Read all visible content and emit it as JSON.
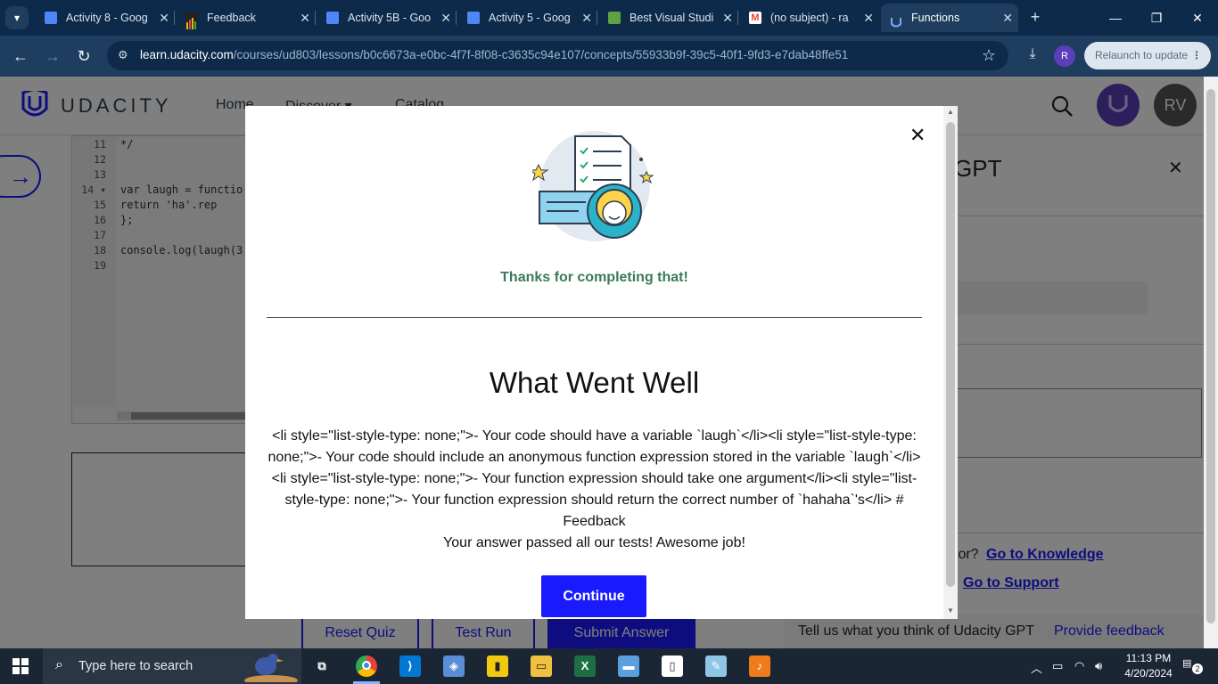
{
  "browser": {
    "tabs": [
      {
        "title": "Activity 8 - Goog",
        "icon": "google-docs-icon",
        "color": "#4f86f7"
      },
      {
        "title": "Feedback",
        "icon": "bar-chart-favicon",
        "color": "#f4b400"
      },
      {
        "title": "Activity 5B - Goo",
        "icon": "google-docs-icon",
        "color": "#4f86f7"
      },
      {
        "title": "Activity 5 - Goog",
        "icon": "google-docs-icon",
        "color": "#4f86f7"
      },
      {
        "title": "Best Visual Studi",
        "icon": "shopify-icon",
        "color": "#5ea33f"
      },
      {
        "title": "(no subject) - ra",
        "icon": "gmail-icon",
        "color": "#ea4335"
      },
      {
        "title": "Functions",
        "icon": "udacity-icon",
        "color": "#7aa7ff"
      }
    ],
    "url_domain": "learn.udacity.com",
    "url_path": "/courses/ud803/lessons/b0c6673a-e0bc-4f7f-8f08-c3635c94e107/concepts/55933b9f-39c5-40f1-9fd3-e7dab48ffe51",
    "profile_initial": "R",
    "relaunch_label": "Relaunch to update"
  },
  "page": {
    "brand": "UDACITY",
    "nav": [
      "Home",
      "Discover ▾",
      "Catalog"
    ],
    "avatar_initials": "RV",
    "editor": {
      "line_numbers": [
        "11",
        "12",
        "13",
        "14 ▾",
        "15",
        "16",
        "17",
        "18",
        "19"
      ],
      "lines": [
        "*/",
        "",
        "",
        "var laugh = functio",
        "    return 'ha'.rep",
        "};",
        "",
        "console.log(laugh(3",
        ""
      ]
    },
    "gpt_title": "GPT",
    "help_prefix": "tor?",
    "help_link_knowledge": "Go to Knowledge",
    "help_link_support": "Go to Support",
    "buttons": {
      "reset": "Reset Quiz",
      "test": "Test Run",
      "submit": "Submit Answer"
    },
    "feedback_prompt": "Tell us what you think of Udacity GPT",
    "feedback_link": "Provide feedback"
  },
  "modal": {
    "thanks": "Thanks for completing that!",
    "heading": "What Went Well",
    "body": "<li style=\"list-style-type: none;\">- Your code should have a variable `laugh`</li><li style=\"list-style-type: none;\">- Your code should include an anonymous function expression stored in the variable `laugh`</li><li style=\"list-style-type: none;\">- Your function expression should take one argument</li><li style=\"list-style-type: none;\">- Your function expression should return the correct number of `hahaha`'s</li> # Feedback",
    "result": "Your answer passed all our tests! Awesome job!",
    "continue_label": "Continue"
  },
  "taskbar": {
    "search_placeholder": "Type here to search",
    "time": "11:13 PM",
    "date": "4/20/2024",
    "notifications": "2",
    "apps": [
      "task-view-icon",
      "chrome-icon",
      "vscode-icon",
      "3d-box-icon",
      "power-bi-icon",
      "file-explorer-icon",
      "excel-icon",
      "remote-desktop-icon",
      "document-icon",
      "notepad-icon",
      "fl-studio-icon"
    ]
  },
  "colors": {
    "accent": "#1a1aff",
    "brand_purple": "#5a3fb8",
    "success_text": "#3a7a5a"
  }
}
